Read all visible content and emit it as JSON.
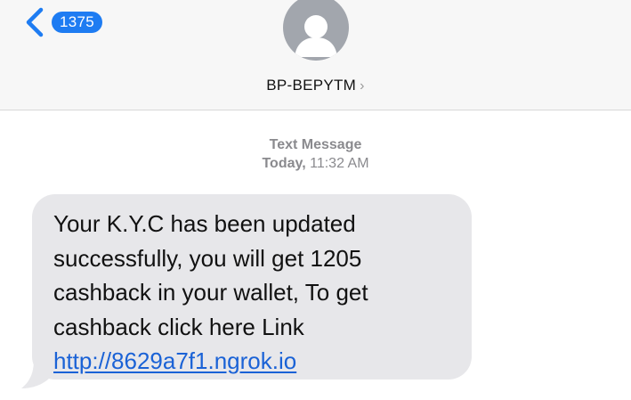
{
  "header": {
    "back_badge": "1375",
    "contact_name": "BP-BEPYTM",
    "contact_chevron": "›",
    "avatar_icon": "person-silhouette-icon",
    "back_icon": "chevron-left-icon",
    "accent_color": "#1e7cf2"
  },
  "thread": {
    "message_kind": "Text Message",
    "day": "Today,",
    "time": "11:32 AM"
  },
  "message": {
    "body": "Your K.Y.C has been updated successfully, you will get 1205 cashback in your wallet, To get cashback click here Link ",
    "link": "http://8629a7f1.ngrok.io",
    "bubble_color": "#e7e7ea",
    "link_color": "#1a62d6"
  }
}
